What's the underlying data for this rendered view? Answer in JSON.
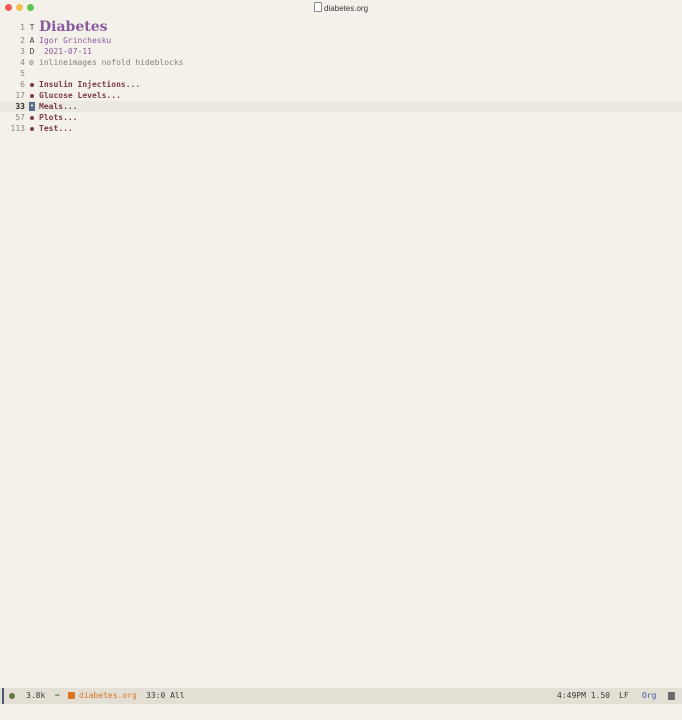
{
  "window": {
    "title": "diabetes.org"
  },
  "lines": {
    "title": {
      "num": "1",
      "mark": "T",
      "text": "Diabetes"
    },
    "author": {
      "num": "2",
      "mark": "A",
      "text": "Igor Grinchesku"
    },
    "date": {
      "num": "3",
      "mark": "D",
      "text": " 2021-07-11"
    },
    "startup": {
      "num": "4",
      "text": "inlineimages nofold hideblocks"
    },
    "blank": {
      "num": "5"
    },
    "h1": {
      "num": "6",
      "text": "Insulin Injections..."
    },
    "h2": {
      "num": "17",
      "text": "Glucose Levels..."
    },
    "h3": {
      "num": "33",
      "text": "Meals..."
    },
    "h4": {
      "num": "57",
      "text": "Plots..."
    },
    "h5": {
      "num": "113",
      "text": "Test..."
    }
  },
  "modeline": {
    "size": "3.8k",
    "filename": "diabetes.org",
    "position": "33:0 All",
    "time": "4:49PM 1.50",
    "eol": "LF",
    "mode": "Org"
  },
  "colors": {
    "title": "#8b5a9e",
    "heading": "#7b3a4a",
    "filename": "#d9731f",
    "background": "#f4f1ea"
  }
}
